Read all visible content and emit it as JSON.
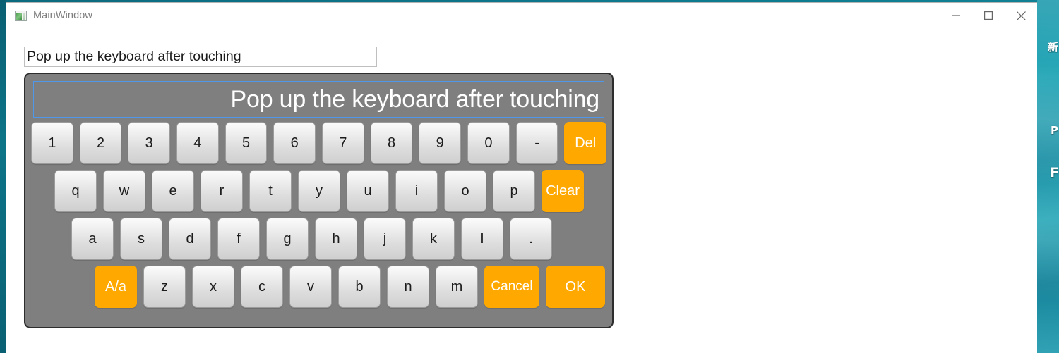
{
  "window": {
    "title": "MainWindow",
    "icon": "app-window-icon",
    "controls": {
      "minimize": "minimize-icon",
      "maximize": "maximize-icon",
      "close": "close-icon"
    }
  },
  "colors": {
    "accent": "#ffa800",
    "panel_background": "#7f7f7f",
    "panel_border": "#2d2d2d",
    "display_border": "#4f97e8",
    "key_text": "#1c1c1c",
    "accent_text": "#ffffff",
    "desktop": "#13889c"
  },
  "form": {
    "text_field_value": "Pop up the keyboard after touching",
    "text_field_placeholder": ""
  },
  "keyboard": {
    "display_value": "Pop up the keyboard after touching",
    "rows": [
      {
        "id": "number-row",
        "keys": [
          {
            "label": "1",
            "name": "key-1",
            "style": "normal"
          },
          {
            "label": "2",
            "name": "key-2",
            "style": "normal"
          },
          {
            "label": "3",
            "name": "key-3",
            "style": "normal"
          },
          {
            "label": "4",
            "name": "key-4",
            "style": "normal"
          },
          {
            "label": "5",
            "name": "key-5",
            "style": "normal"
          },
          {
            "label": "6",
            "name": "key-6",
            "style": "normal"
          },
          {
            "label": "7",
            "name": "key-7",
            "style": "normal"
          },
          {
            "label": "8",
            "name": "key-8",
            "style": "normal"
          },
          {
            "label": "9",
            "name": "key-9",
            "style": "normal"
          },
          {
            "label": "0",
            "name": "key-0",
            "style": "normal"
          },
          {
            "label": "-",
            "name": "key-minus",
            "style": "normal"
          },
          {
            "label": "Del",
            "name": "key-delete",
            "style": "accent"
          }
        ]
      },
      {
        "id": "qwerty-row",
        "keys": [
          {
            "label": "q",
            "name": "key-q",
            "style": "normal"
          },
          {
            "label": "w",
            "name": "key-w",
            "style": "normal"
          },
          {
            "label": "e",
            "name": "key-e",
            "style": "normal"
          },
          {
            "label": "r",
            "name": "key-r",
            "style": "normal"
          },
          {
            "label": "t",
            "name": "key-t",
            "style": "normal"
          },
          {
            "label": "y",
            "name": "key-y",
            "style": "normal"
          },
          {
            "label": "u",
            "name": "key-u",
            "style": "normal"
          },
          {
            "label": "i",
            "name": "key-i",
            "style": "normal"
          },
          {
            "label": "o",
            "name": "key-o",
            "style": "normal"
          },
          {
            "label": "p",
            "name": "key-p",
            "style": "normal"
          },
          {
            "label": "Clear",
            "name": "key-clear",
            "style": "accent"
          }
        ]
      },
      {
        "id": "home-row",
        "keys": [
          {
            "label": "a",
            "name": "key-a",
            "style": "normal"
          },
          {
            "label": "s",
            "name": "key-s",
            "style": "normal"
          },
          {
            "label": "d",
            "name": "key-d",
            "style": "normal"
          },
          {
            "label": "f",
            "name": "key-f",
            "style": "normal"
          },
          {
            "label": "g",
            "name": "key-g",
            "style": "normal"
          },
          {
            "label": "h",
            "name": "key-h",
            "style": "normal"
          },
          {
            "label": "j",
            "name": "key-j",
            "style": "normal"
          },
          {
            "label": "k",
            "name": "key-k",
            "style": "normal"
          },
          {
            "label": "l",
            "name": "key-l",
            "style": "normal"
          },
          {
            "label": ".",
            "name": "key-period",
            "style": "normal"
          }
        ]
      },
      {
        "id": "bottom-row",
        "keys": [
          {
            "label": "A/a",
            "name": "key-shift-case",
            "style": "accent"
          },
          {
            "label": "z",
            "name": "key-z",
            "style": "normal"
          },
          {
            "label": "x",
            "name": "key-x",
            "style": "normal"
          },
          {
            "label": "c",
            "name": "key-c",
            "style": "normal"
          },
          {
            "label": "v",
            "name": "key-v",
            "style": "normal"
          },
          {
            "label": "b",
            "name": "key-b",
            "style": "normal"
          },
          {
            "label": "n",
            "name": "key-n",
            "style": "normal"
          },
          {
            "label": "m",
            "name": "key-m",
            "style": "normal"
          },
          {
            "label": "Cancel",
            "name": "key-cancel",
            "style": "accent-wide"
          },
          {
            "label": "OK",
            "name": "key-ok",
            "style": "accent-wide2"
          }
        ]
      }
    ]
  },
  "desktop": {
    "glyphs": [
      "新",
      "P",
      "F"
    ]
  }
}
